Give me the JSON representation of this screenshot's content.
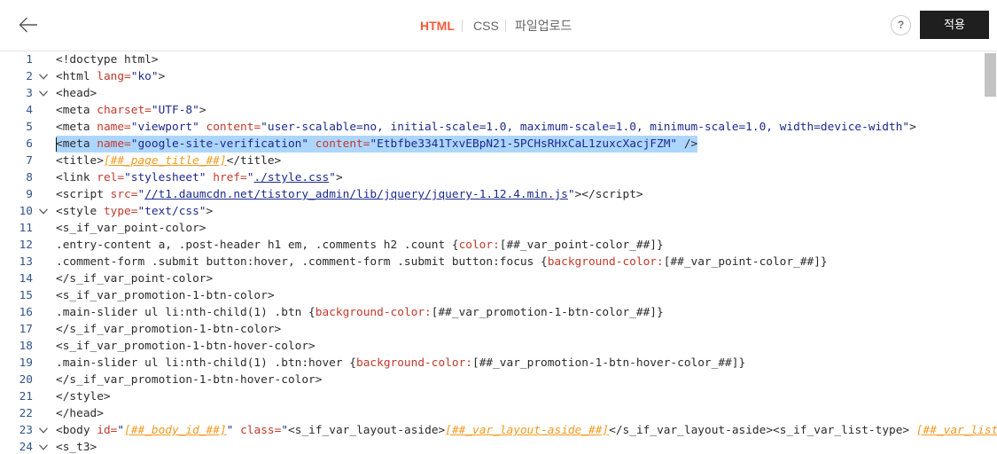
{
  "header": {
    "back_icon": "back-arrow-icon",
    "tabs": [
      {
        "label": "HTML",
        "active": true
      },
      {
        "label": "CSS",
        "active": false
      },
      {
        "label": "파일업로드",
        "active": false
      }
    ],
    "help_label": "?",
    "apply_label": "적용"
  },
  "colors": {
    "accent": "#f25a3a",
    "apply_button": "#1f1f1f",
    "selection": "#add6ff",
    "tag": "#2b2b2b",
    "attribute": "#c1392b",
    "string": "#1c2a8c",
    "template_variable": "#f29a1f",
    "line_number": "#33548a"
  },
  "editor": {
    "lines": [
      {
        "number": "1",
        "foldable": false,
        "tokens": [
          {
            "type": "tag",
            "text": "<!doctype html>"
          }
        ]
      },
      {
        "number": "2",
        "foldable": true,
        "tokens": [
          {
            "type": "tag",
            "text": "<html "
          },
          {
            "type": "attr",
            "text": "lang="
          },
          {
            "type": "string",
            "text": "\"ko\""
          },
          {
            "type": "tag",
            "text": ">"
          }
        ]
      },
      {
        "number": "3",
        "foldable": true,
        "tokens": [
          {
            "type": "tag",
            "text": "<head>"
          }
        ]
      },
      {
        "number": "4",
        "foldable": false,
        "tokens": [
          {
            "type": "tag",
            "text": "<meta "
          },
          {
            "type": "attr",
            "text": "charset="
          },
          {
            "type": "string",
            "text": "\"UTF-8\""
          },
          {
            "type": "tag",
            "text": ">"
          }
        ]
      },
      {
        "number": "5",
        "foldable": false,
        "tokens": [
          {
            "type": "tag",
            "text": "<meta "
          },
          {
            "type": "attr",
            "text": "name="
          },
          {
            "type": "string",
            "text": "\"viewport\" "
          },
          {
            "type": "attr",
            "text": "content="
          },
          {
            "type": "string",
            "text": "\"user-scalable=no, initial-scale=1.0, maximum-scale=1.0, minimum-scale=1.0, width=device-width\""
          },
          {
            "type": "tag",
            "text": ">"
          }
        ]
      },
      {
        "number": "6",
        "foldable": false,
        "selected": true,
        "tokens": [
          {
            "type": "tag",
            "text": "<meta "
          },
          {
            "type": "attr",
            "text": "name="
          },
          {
            "type": "string",
            "text": "\"google-site-verification\" "
          },
          {
            "type": "attr",
            "text": "content="
          },
          {
            "type": "string",
            "text": "\"Etbfbe3341TxvEBpN21-5PCHsRHxCaL1zuxcXacjFZM\" "
          },
          {
            "type": "tag",
            "text": "/>"
          }
        ]
      },
      {
        "number": "7",
        "foldable": false,
        "tokens": [
          {
            "type": "tag",
            "text": "<title>"
          },
          {
            "type": "var",
            "text": "[##_page_title_##]"
          },
          {
            "type": "tag",
            "text": "</title>"
          }
        ]
      },
      {
        "number": "8",
        "foldable": false,
        "tokens": [
          {
            "type": "tag",
            "text": "<link "
          },
          {
            "type": "attr",
            "text": "rel="
          },
          {
            "type": "string",
            "text": "\"stylesheet\" "
          },
          {
            "type": "attr",
            "text": "href="
          },
          {
            "type": "string",
            "text": "\""
          },
          {
            "type": "link",
            "text": "./style.css"
          },
          {
            "type": "string",
            "text": "\""
          },
          {
            "type": "tag",
            "text": ">"
          }
        ]
      },
      {
        "number": "9",
        "foldable": false,
        "tokens": [
          {
            "type": "tag",
            "text": "<script "
          },
          {
            "type": "attr",
            "text": "src="
          },
          {
            "type": "string",
            "text": "\""
          },
          {
            "type": "link",
            "text": "//t1.daumcdn.net/tistory_admin/lib/jquery/jquery-1.12.4.min.js"
          },
          {
            "type": "string",
            "text": "\""
          },
          {
            "type": "tag",
            "text": "></script>"
          }
        ]
      },
      {
        "number": "10",
        "foldable": true,
        "tokens": [
          {
            "type": "tag",
            "text": "<style "
          },
          {
            "type": "attr",
            "text": "type="
          },
          {
            "type": "string",
            "text": "\"text/css\""
          },
          {
            "type": "tag",
            "text": ">"
          }
        ]
      },
      {
        "number": "11",
        "foldable": false,
        "tokens": [
          {
            "type": "tag",
            "text": "<s_if_var_point-color>"
          }
        ]
      },
      {
        "number": "12",
        "foldable": false,
        "tokens": [
          {
            "type": "plain",
            "text": ".entry-content a, .post-header h1 em, .comments h2 .count {"
          },
          {
            "type": "prop",
            "text": "color:"
          },
          {
            "type": "plain",
            "text": "[##_var_point-color_##]}"
          }
        ]
      },
      {
        "number": "13",
        "foldable": false,
        "tokens": [
          {
            "type": "plain",
            "text": ".comment-form .submit button:hover, .comment-form .submit button:focus {"
          },
          {
            "type": "prop",
            "text": "background-color:"
          },
          {
            "type": "plain",
            "text": "[##_var_point-color_##]}"
          }
        ]
      },
      {
        "number": "14",
        "foldable": false,
        "tokens": [
          {
            "type": "tag",
            "text": "</s_if_var_point-color>"
          }
        ]
      },
      {
        "number": "15",
        "foldable": false,
        "tokens": [
          {
            "type": "tag",
            "text": "<s_if_var_promotion-1-btn-color>"
          }
        ]
      },
      {
        "number": "16",
        "foldable": false,
        "tokens": [
          {
            "type": "plain",
            "text": ".main-slider ul li:nth-child(1) .btn {"
          },
          {
            "type": "prop",
            "text": "background-color:"
          },
          {
            "type": "plain",
            "text": "[##_var_promotion-1-btn-color_##]}"
          }
        ]
      },
      {
        "number": "17",
        "foldable": false,
        "tokens": [
          {
            "type": "tag",
            "text": "</s_if_var_promotion-1-btn-color>"
          }
        ]
      },
      {
        "number": "18",
        "foldable": false,
        "tokens": [
          {
            "type": "tag",
            "text": "<s_if_var_promotion-1-btn-hover-color>"
          }
        ]
      },
      {
        "number": "19",
        "foldable": false,
        "tokens": [
          {
            "type": "plain",
            "text": ".main-slider ul li:nth-child(1) .btn:hover {"
          },
          {
            "type": "prop",
            "text": "background-color:"
          },
          {
            "type": "plain",
            "text": "[##_var_promotion-1-btn-hover-color_##]}"
          }
        ]
      },
      {
        "number": "20",
        "foldable": false,
        "tokens": [
          {
            "type": "tag",
            "text": "</s_if_var_promotion-1-btn-hover-color>"
          }
        ]
      },
      {
        "number": "21",
        "foldable": false,
        "tokens": [
          {
            "type": "tag",
            "text": "</style>"
          }
        ]
      },
      {
        "number": "22",
        "foldable": false,
        "tokens": [
          {
            "type": "tag",
            "text": "</head>"
          }
        ]
      },
      {
        "number": "23",
        "foldable": true,
        "tokens": [
          {
            "type": "tag",
            "text": "<body "
          },
          {
            "type": "attr",
            "text": "id="
          },
          {
            "type": "string",
            "text": "\""
          },
          {
            "type": "var",
            "text": "[##_body_id_##]"
          },
          {
            "type": "string",
            "text": "\" "
          },
          {
            "type": "attr",
            "text": "class="
          },
          {
            "type": "string",
            "text": "\""
          },
          {
            "type": "tag",
            "text": "<s_if_var_layout-aside>"
          },
          {
            "type": "var",
            "text": "[##_var_layout-aside_##]"
          },
          {
            "type": "tag",
            "text": "</s_if_var_layout-aside><s_if_var_list-type> "
          },
          {
            "type": "var",
            "text": "[##_var_list"
          }
        ]
      },
      {
        "number": "24",
        "foldable": true,
        "tokens": [
          {
            "type": "tag",
            "text": "<s_t3>"
          }
        ]
      }
    ]
  }
}
